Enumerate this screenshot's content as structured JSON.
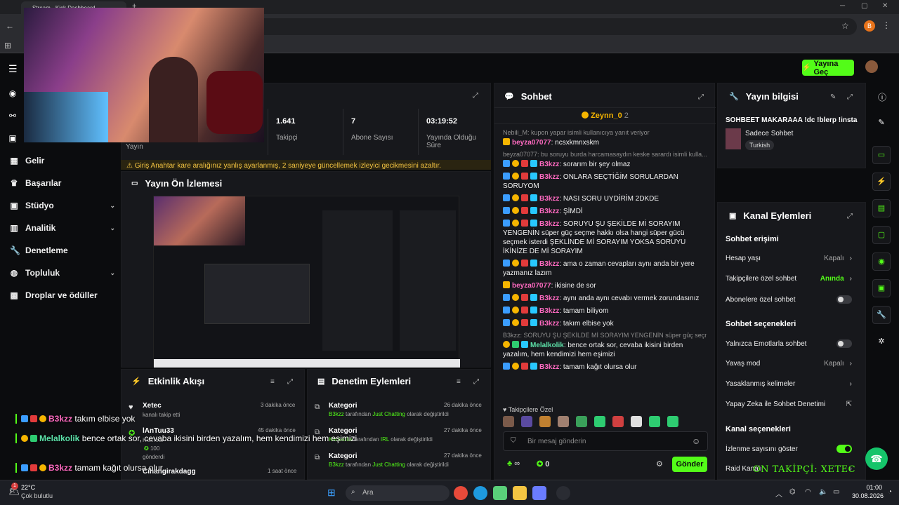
{
  "browser": {
    "tab_title": "Stream - Kick Dashboard",
    "new_tab": "+",
    "profile_initial": "B"
  },
  "header": {
    "go_live_button": "Yayına Geç"
  },
  "sidebar": {
    "items": [
      {
        "label": "Gelir",
        "icon": "bank-icon"
      },
      {
        "label": "Başarılar",
        "icon": "trophy-icon"
      },
      {
        "label": "Stüdyo",
        "icon": "studio-icon",
        "expandable": true
      },
      {
        "label": "Analitik",
        "icon": "chart-icon",
        "expandable": true
      },
      {
        "label": "Denetleme",
        "icon": "wrench-icon"
      },
      {
        "label": "Topluluk",
        "icon": "community-icon",
        "expandable": true
      },
      {
        "label": "Droplar ve ödüller",
        "icon": "gift-icon"
      }
    ]
  },
  "stats": {
    "partial_label": "Yayın",
    "items": [
      {
        "value": "1.641",
        "label": "Takipçi"
      },
      {
        "value": "7",
        "label": "Abone Sayısı"
      },
      {
        "value": "03:19:52",
        "label": "Yayında Olduğu Süre"
      }
    ],
    "warning": "Giriş Anahtar kare aralığınız yanlış ayarlanmış, 2 saniyeye güncellemek izleyici gecikmesini azaltır."
  },
  "preview": {
    "title": "Yayın Ön İzlemesi"
  },
  "activity": {
    "title": "Etkinlik Akışı",
    "items": [
      {
        "name": "Xetec",
        "sub": "kanalı takip etti",
        "time": "3 dakika önce"
      },
      {
        "name": "lAnTuu33",
        "sub": "Kick'ledi",
        "time": "45 dakika önce",
        "amount": "100",
        "sub2": "gönderdi"
      },
      {
        "name": "Cihangirakdagg",
        "sub": "",
        "time": "1 saat önce"
      }
    ]
  },
  "moderation": {
    "title": "Denetim Eylemleri",
    "items": [
      {
        "title": "Kategori",
        "line": "B3kzz tarafından Just Chatting olarak değiştirildi",
        "time": "26 dakika önce"
      },
      {
        "title": "Kategori",
        "line": "Karakolia tarafından IRL olarak değiştirildi",
        "time": "27 dakika önce"
      },
      {
        "title": "Kategori",
        "line": "B3kzz tarafından Just Chatting olarak değiştirildi",
        "time": "27 dakika önce"
      }
    ]
  },
  "chat": {
    "title": "Sohbet",
    "pinned_user": "Zeynn_0",
    "pinned_count": "2",
    "messages": [
      {
        "reply": "Nebili_M: kupon yapar isimli kullanıcıya yanıt veriyor"
      },
      {
        "user": "beyza07077",
        "text": ": ncsxkmnxskm",
        "style": "crown"
      },
      {
        "reply": "beyza07077: bu soruyu burda harcamasaydın keske sarardı isimli kulla..."
      },
      {
        "user": "B3kzz",
        "text": ": sorarım bir şey olmaz",
        "style": "mod"
      },
      {
        "user": "B3kzz",
        "text": ": ONLARA SEÇTİĞİM SORULARDAN SORUYOM",
        "style": "mod"
      },
      {
        "user": "B3kzz",
        "text": ": NASI SORU UYDİRİM 2DKDE",
        "style": "mod"
      },
      {
        "user": "B3kzz",
        "text": ": ŞİMDİ",
        "style": "mod"
      },
      {
        "user": "B3kzz",
        "text": ": SORUYU ŞU ŞEKİLDE Mİ SORAYIM YENGENİN süper güç seçme hakkı olsa hangi süper gücü seçmek isterdi ŞEKLİNDE Mİ SORAYIM YOKSA SORUYU İKİNİZE DE Mİ SORAYIM",
        "style": "mod"
      },
      {
        "user": "B3kzz",
        "text": ": ama o zaman cevapları aynı anda bir yere yazmanız lazım",
        "style": "mod"
      },
      {
        "user": "beyza07077",
        "text": ": ikisine de sor",
        "style": "crown"
      },
      {
        "user": "B3kzz",
        "text": ": aynı anda aynı cevabı vermek zorundasınız",
        "style": "mod"
      },
      {
        "user": "B3kzz",
        "text": ": tamam biliyom",
        "style": "mod"
      },
      {
        "user": "B3kzz",
        "text": ": takım elbise yok",
        "style": "mod"
      },
      {
        "reply": "B3kzz: SORUYU ŞU ŞEKİLDE Mİ SORAYIM YENGENİN süper güç seçm..."
      },
      {
        "user": "Melalkolik",
        "text": ": bence ortak sor, cevaba ikisini birden yazalım, hem kendimizi hem eşimizi",
        "style": "vip"
      },
      {
        "user": "B3kzz",
        "text": ": tamam kağıt olursa olur",
        "style": "mod"
      }
    ],
    "followers_only": "Takipçilere Özel",
    "input_placeholder": "Bir mesaj gönderin",
    "infinity": "∞",
    "points": "0",
    "send_button": "Gönder"
  },
  "stream_info": {
    "title": "Yayın bilgisi",
    "stream_title": "SOHBEET MAKARAAA !dc !blerp !insta",
    "category": "Sadece Sohbet",
    "tag": "Turkish"
  },
  "channel_actions": {
    "title": "Kanal Eylemleri",
    "chat_access_title": "Sohbet erişimi",
    "chat_access": [
      {
        "label": "Hesap yaşı",
        "value": "Kapalı",
        "type": "link"
      },
      {
        "label": "Takipçilere özel sohbet",
        "value": "Anında",
        "type": "link",
        "green": true
      },
      {
        "label": "Abonelere özel sohbet",
        "type": "toggle",
        "on": false
      }
    ],
    "chat_options_title": "Sohbet seçenekleri",
    "chat_options": [
      {
        "label": "Yalnızca Emotlarla sohbet",
        "type": "toggle",
        "on": false
      },
      {
        "label": "Yavaş mod",
        "value": "Kapalı",
        "type": "link"
      },
      {
        "label": "Yasaklanmış kelimeler",
        "value": "",
        "type": "link"
      },
      {
        "label": "Yapay Zeka ile Sohbet Denetimi",
        "value": "",
        "type": "external"
      }
    ],
    "channel_options_title": "Kanal seçenekleri",
    "channel_options": [
      {
        "label": "İzlenme sayısını göster",
        "type": "toggle",
        "on": true
      },
      {
        "label": "Raid Kanalı",
        "value": "",
        "type": "link"
      }
    ]
  },
  "overlay": {
    "chat": [
      {
        "user": "B3kzz",
        "text": "takım elbise yok"
      },
      {
        "user": "Melalkolik",
        "text": "bence ortak sor, cevaba ikisini birden yazalım, hem kendimizi hem eşimizi"
      },
      {
        "user": "B3kzz",
        "text": "tamam kağıt olursa olur"
      }
    ],
    "follower_banner": "ON TAKİPÇİ: XETEC"
  },
  "taskbar": {
    "temperature": "22°C",
    "weather": "Çok bulutlu",
    "notif_count": "1",
    "search_placeholder": "Ara",
    "time": "01:00",
    "date": "30.08.2026"
  }
}
